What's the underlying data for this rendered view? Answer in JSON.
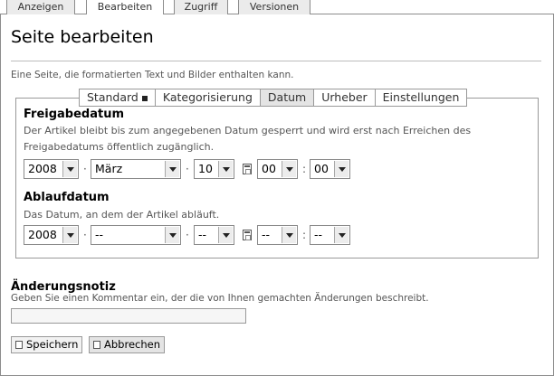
{
  "top_tabs": [
    {
      "label": "Anzeigen",
      "active": false
    },
    {
      "label": "Bearbeiten",
      "active": true
    },
    {
      "label": "Zugriff",
      "active": false
    },
    {
      "label": "Versionen",
      "active": false
    }
  ],
  "page": {
    "title": "Seite bearbeiten",
    "description": "Eine Seite, die formatierten Text und Bilder enthalten kann."
  },
  "sub_tabs": [
    {
      "label": "Standard",
      "active": false,
      "icon": "square-icon"
    },
    {
      "label": "Kategorisierung",
      "active": false
    },
    {
      "label": "Datum",
      "active": true
    },
    {
      "label": "Urheber",
      "active": false
    },
    {
      "label": "Einstellungen",
      "active": false
    }
  ],
  "effective": {
    "heading": "Freigabedatum",
    "help_line1": "Der Artikel bleibt bis zum angegebenen Datum gesperrt und wird erst nach Erreichen des",
    "help_line2": "Freigabedatums öffentlich zugänglich.",
    "year": "2008",
    "month": "März",
    "day": "10",
    "hour": "00",
    "minute": "00",
    "sep_dot": "·",
    "sep_colon": ":"
  },
  "expiration": {
    "heading": "Ablaufdatum",
    "help": "Das Datum, an dem der Artikel abläuft.",
    "year": "2008",
    "month": "--",
    "day": "--",
    "hour": "--",
    "minute": "--",
    "sep_dot": "·",
    "sep_colon": ":"
  },
  "note": {
    "heading": "Änderungsnotiz",
    "help": "Geben Sie einen Kommentar ein, der die von Ihnen gemachten Änderungen beschreibt.",
    "value": "",
    "placeholder": ""
  },
  "buttons": {
    "save_label": "Speichern",
    "cancel_label": "Abbrechen"
  },
  "icons": {
    "calendar": "calendar-icon",
    "save": "save-icon",
    "cancel": "cancel-icon"
  }
}
